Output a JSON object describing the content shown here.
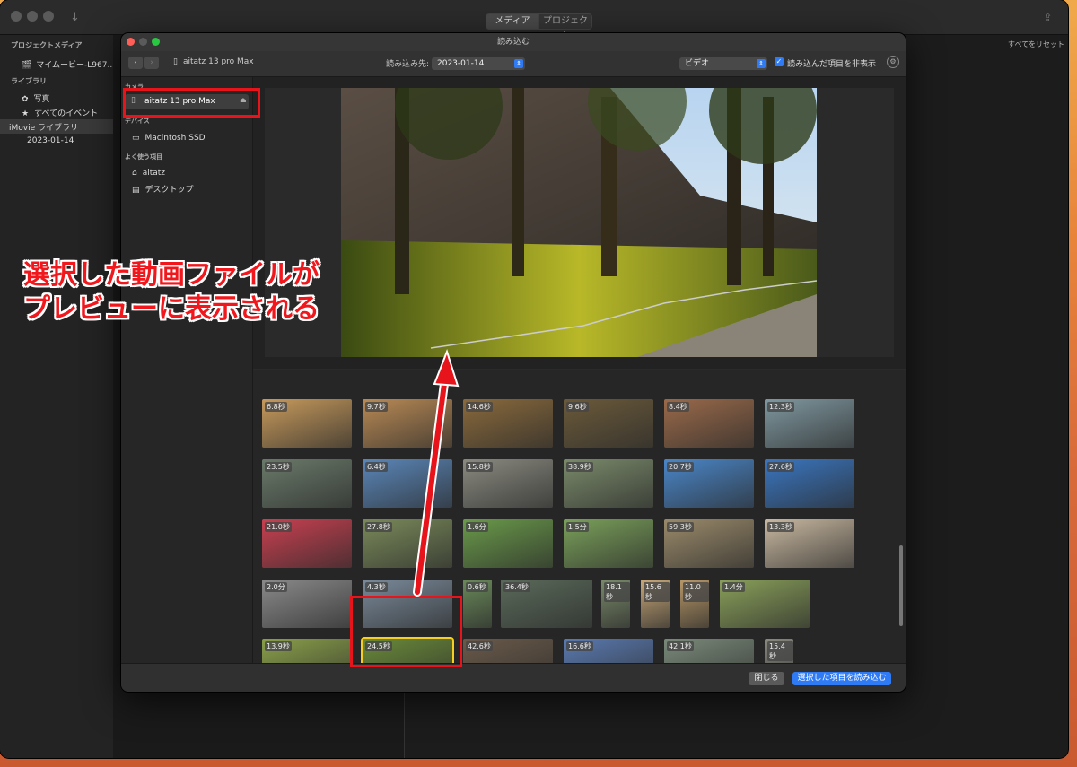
{
  "app": {
    "tabs": [
      "メディア",
      "プロジェクト"
    ],
    "reset_label": "すべてをリセット"
  },
  "sidebar": {
    "project_media_header": "プロジェクトメディア",
    "project_item": "マイムービー-L967...",
    "library_header": "ライブラリ",
    "photos": "写真",
    "all_events": "すべてのイベント",
    "imovie_library": "iMovie ライブラリ",
    "event_date": "2023-01-14"
  },
  "dialog": {
    "title": "読み込む",
    "device_name": "aitatz 13 pro Max",
    "import_to_label": "読み込み先:",
    "import_to_value": "2023-01-14",
    "filter_value": "ビデオ",
    "hide_imported_label": "読み込んだ項目を非表示",
    "hide_imported_checked": true,
    "side": {
      "camera_header": "カメラ",
      "camera_item": "aitatz 13 pro Max",
      "devices_header": "デバイス",
      "device_item": "Macintosh SSD",
      "favorites_header": "よく使う項目",
      "fav_home": "aitatz",
      "fav_desktop": "デスクトップ"
    },
    "close_button": "閉じる",
    "import_selected_button": "選択した項目を読み込む"
  },
  "clips": [
    {
      "dur": "6.8秒",
      "color": "#c79a5c"
    },
    {
      "dur": "9.7秒",
      "color": "#b98a55"
    },
    {
      "dur": "14.6秒",
      "color": "#8a6a3c"
    },
    {
      "dur": "9.6秒",
      "color": "#6b5a3a"
    },
    {
      "dur": "8.4秒",
      "color": "#9a6a4a"
    },
    {
      "dur": "12.3秒",
      "color": "#7f98a0"
    },
    {
      "dur": "23.5秒",
      "color": "#6a7a6a"
    },
    {
      "dur": "6.4秒",
      "color": "#5a86b8"
    },
    {
      "dur": "15.8秒",
      "color": "#8a8a80"
    },
    {
      "dur": "38.9秒",
      "color": "#7a8a6a"
    },
    {
      "dur": "20.7秒",
      "color": "#4a86c8"
    },
    {
      "dur": "27.6秒",
      "color": "#3a76c0"
    },
    {
      "dur": "21.0秒",
      "color": "#c84050"
    },
    {
      "dur": "27.8秒",
      "color": "#7a8a5a"
    },
    {
      "dur": "1.6分",
      "color": "#6a9a4a"
    },
    {
      "dur": "1.5分",
      "color": "#7aa05a"
    },
    {
      "dur": "59.3秒",
      "color": "#9a8a6a"
    },
    {
      "dur": "13.3秒",
      "color": "#c8b8a0"
    },
    {
      "dur": "2.0分",
      "color": "#8a8a8a"
    },
    {
      "dur": "4.3秒",
      "color": "#7a8a9a"
    },
    {
      "dur": "0.6秒",
      "color": "#6a8a5a"
    },
    {
      "dur": "36.4秒",
      "color": "#5a6a5a"
    },
    {
      "dur": "18.1秒",
      "color": "#7a8a6a"
    },
    {
      "dur": "15.6秒",
      "color": "#c8a878"
    },
    {
      "dur": "11.0秒",
      "color": "#b89868"
    },
    {
      "dur": "1.4分",
      "color": "#8aa05a"
    },
    {
      "dur": "13.9秒",
      "color": "#8aa04a"
    },
    {
      "dur": "24.5秒",
      "color": "#6a8a3a"
    },
    {
      "dur": "42.6秒",
      "color": "#6a5a4a"
    },
    {
      "dur": "16.6秒",
      "color": "#5a7ab0"
    },
    {
      "dur": "42.1秒",
      "color": "#7a8a7a"
    },
    {
      "dur": "15.4秒",
      "color": "#8a8a80"
    }
  ],
  "annotation": {
    "line1": "選択した動画ファイルが",
    "line2": "プレビューに表示される"
  }
}
